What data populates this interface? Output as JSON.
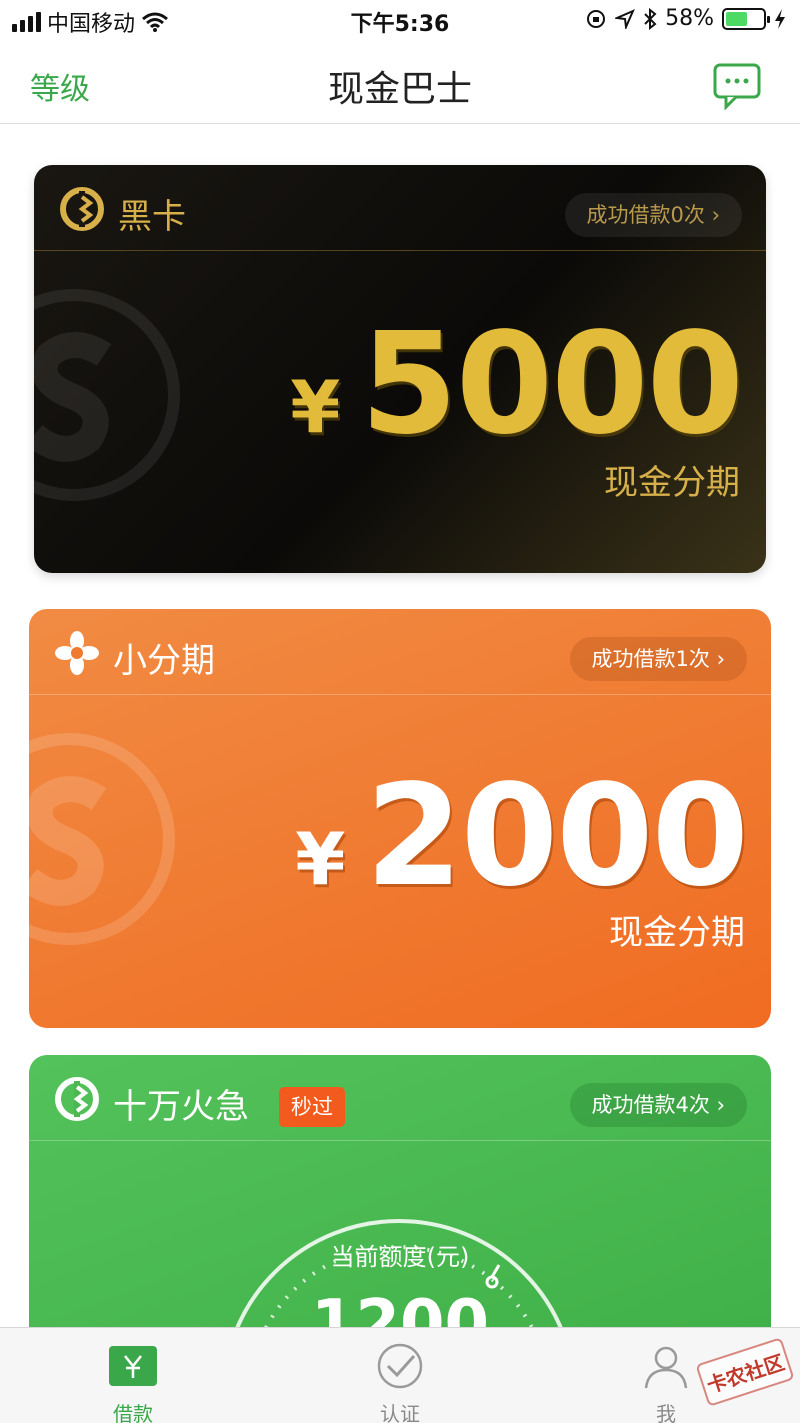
{
  "status_bar": {
    "carrier": "中国移动",
    "time": "下午5:36",
    "battery": "58%",
    "battery_level": 0.58
  },
  "nav": {
    "left": "等级",
    "title": "现金巴士",
    "right_icon": "chat-bubble-icon"
  },
  "cards": [
    {
      "name": "黑卡",
      "success": "成功借款0次",
      "currency": "¥",
      "amount": "5000",
      "subtitle": "现金分期",
      "accent": "#e3bb3a"
    },
    {
      "name": "小分期",
      "success": "成功借款1次",
      "currency": "¥",
      "amount": "2000",
      "subtitle": "现金分期",
      "accent": "#f07a30"
    },
    {
      "name": "十万火急",
      "tag": "秒过",
      "success": "成功借款4次",
      "gauge_label": "当前额度(元)",
      "gauge_value": "1200",
      "accent": "#4cb852"
    }
  ],
  "tabs": [
    {
      "label": "借款",
      "icon": "yen-box-icon",
      "active": true
    },
    {
      "label": "认证",
      "icon": "check-circle-icon",
      "active": false
    },
    {
      "label": "我",
      "icon": "person-icon",
      "active": false
    }
  ],
  "watermark_text": "卡农社区"
}
